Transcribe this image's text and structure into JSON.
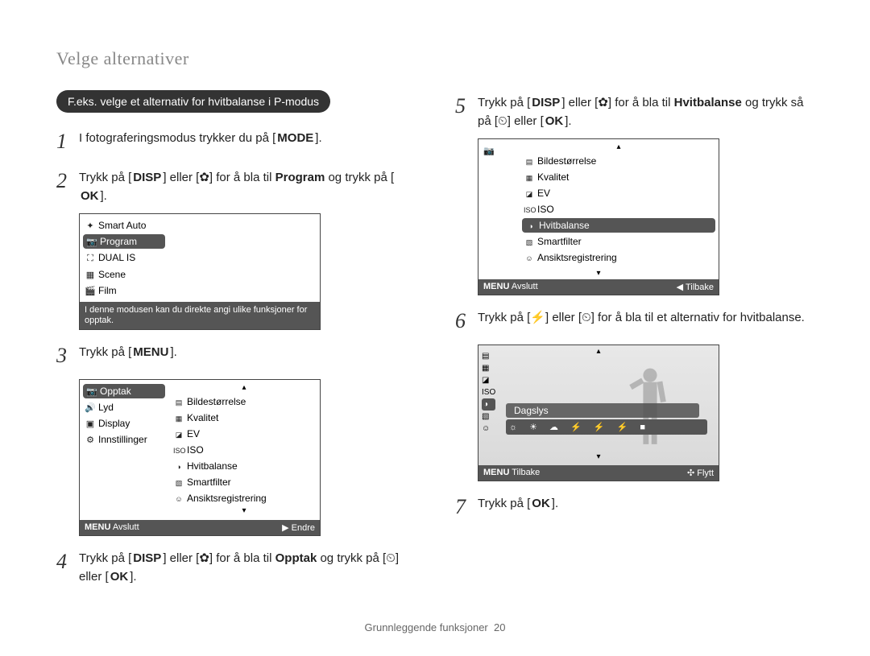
{
  "header_title": "Velge alternativer",
  "pill": "F.eks. velge et alternativ for hvitbalanse i P-modus",
  "steps": {
    "s1": {
      "num": "1",
      "pre": "I fotograferingsmodus trykker du på [",
      "key": "MODE",
      "post": "]."
    },
    "s2": {
      "num": "2",
      "p1": "Trykk på [",
      "key1": "DISP",
      "p2": "] eller [",
      "key2": "✿",
      "p3": "] for å bla til ",
      "bold": "Program",
      "p4": " og trykk på [",
      "key3": "OK",
      "p5": "]."
    },
    "s3": {
      "num": "3",
      "pre": "Trykk på [",
      "key": "MENU",
      "post": "]."
    },
    "s4": {
      "num": "4",
      "p1": "Trykk på [",
      "key1": "DISP",
      "p2": "] eller [",
      "key2": "✿",
      "p3": "] for å bla til ",
      "bold": "Opptak",
      "p4": " og trykk på [",
      "key3": "⏲",
      "p5": "] eller [",
      "key4": "OK",
      "p6": "]."
    },
    "s5": {
      "num": "5",
      "p1": "Trykk på [",
      "key1": "DISP",
      "p2": "] eller [",
      "key2": "✿",
      "p3": "] for å bla til ",
      "bold": "Hvitbalanse",
      "p4": " og trykk så på [",
      "key3": "⏲",
      "p5": "] eller [",
      "key4": "OK",
      "p6": "]."
    },
    "s6": {
      "num": "6",
      "p1": "Trykk på [",
      "key1": "⚡",
      "p2": "] eller [",
      "key2": "⏲",
      "p3": "] for å bla til et alternativ for hvitbalanse."
    },
    "s7": {
      "num": "7",
      "pre": "Trykk på [",
      "key": "OK",
      "post": "]."
    }
  },
  "screen_mode": {
    "items": [
      {
        "icon": "✦",
        "label": "Smart Auto",
        "selected": false
      },
      {
        "icon": "📷",
        "label": "Program",
        "selected": true
      },
      {
        "icon": "⛶",
        "label": "DUAL IS",
        "selected": false
      },
      {
        "icon": "▦",
        "label": "Scene",
        "selected": false
      },
      {
        "icon": "🎬",
        "label": "Film",
        "selected": false
      }
    ],
    "desc": "I denne modusen kan du direkte angi ulike funksjoner for opptak."
  },
  "screen_menu": {
    "left": [
      {
        "icon": "📷",
        "label": "Opptak",
        "selected": true
      },
      {
        "icon": "🔊",
        "label": "Lyd",
        "selected": false
      },
      {
        "icon": "▣",
        "label": "Display",
        "selected": false
      },
      {
        "icon": "⚙",
        "label": "Innstillinger",
        "selected": false
      }
    ],
    "right": [
      {
        "icon": "▤",
        "label": "Bildestørrelse"
      },
      {
        "icon": "▦",
        "label": "Kvalitet"
      },
      {
        "icon": "◪",
        "label": "EV"
      },
      {
        "icon": "ISO",
        "label": "ISO"
      },
      {
        "icon": "◑",
        "label": "Hvitbalanse"
      },
      {
        "icon": "▧",
        "label": "Smartfilter"
      },
      {
        "icon": "☺",
        "label": "Ansiktsregistrering"
      }
    ],
    "footer_left_key": "MENU",
    "footer_left": "Avslutt",
    "footer_right_icon": "▶",
    "footer_right": "Endre"
  },
  "screen_hb": {
    "left_icon": "📷",
    "right": [
      {
        "icon": "▤",
        "label": "Bildestørrelse",
        "selected": false
      },
      {
        "icon": "▦",
        "label": "Kvalitet",
        "selected": false
      },
      {
        "icon": "◪",
        "label": "EV",
        "selected": false
      },
      {
        "icon": "ISO",
        "label": "ISO",
        "selected": false
      },
      {
        "icon": "◑",
        "label": "Hvitbalanse",
        "selected": true
      },
      {
        "icon": "▧",
        "label": "Smartfilter",
        "selected": false
      },
      {
        "icon": "☺",
        "label": "Ansiktsregistrering",
        "selected": false
      }
    ],
    "footer_left_key": "MENU",
    "footer_left": "Avslutt",
    "footer_right_icon": "◀",
    "footer_right": "Tilbake"
  },
  "screen_wb": {
    "selected_label": "Dagslys",
    "strip": "☼ ☀ ☁ ⚡ ⚡ ⚡ ■",
    "left_icons": [
      "▤",
      "▦",
      "◪",
      "ISO",
      "◑",
      "▧",
      "☺"
    ],
    "selected_index": 4,
    "footer_left_key": "MENU",
    "footer_left": "Tilbake",
    "footer_right_icon": "✣",
    "footer_right": "Flytt"
  },
  "footer": {
    "label": "Grunnleggende funksjoner",
    "page": "20"
  }
}
